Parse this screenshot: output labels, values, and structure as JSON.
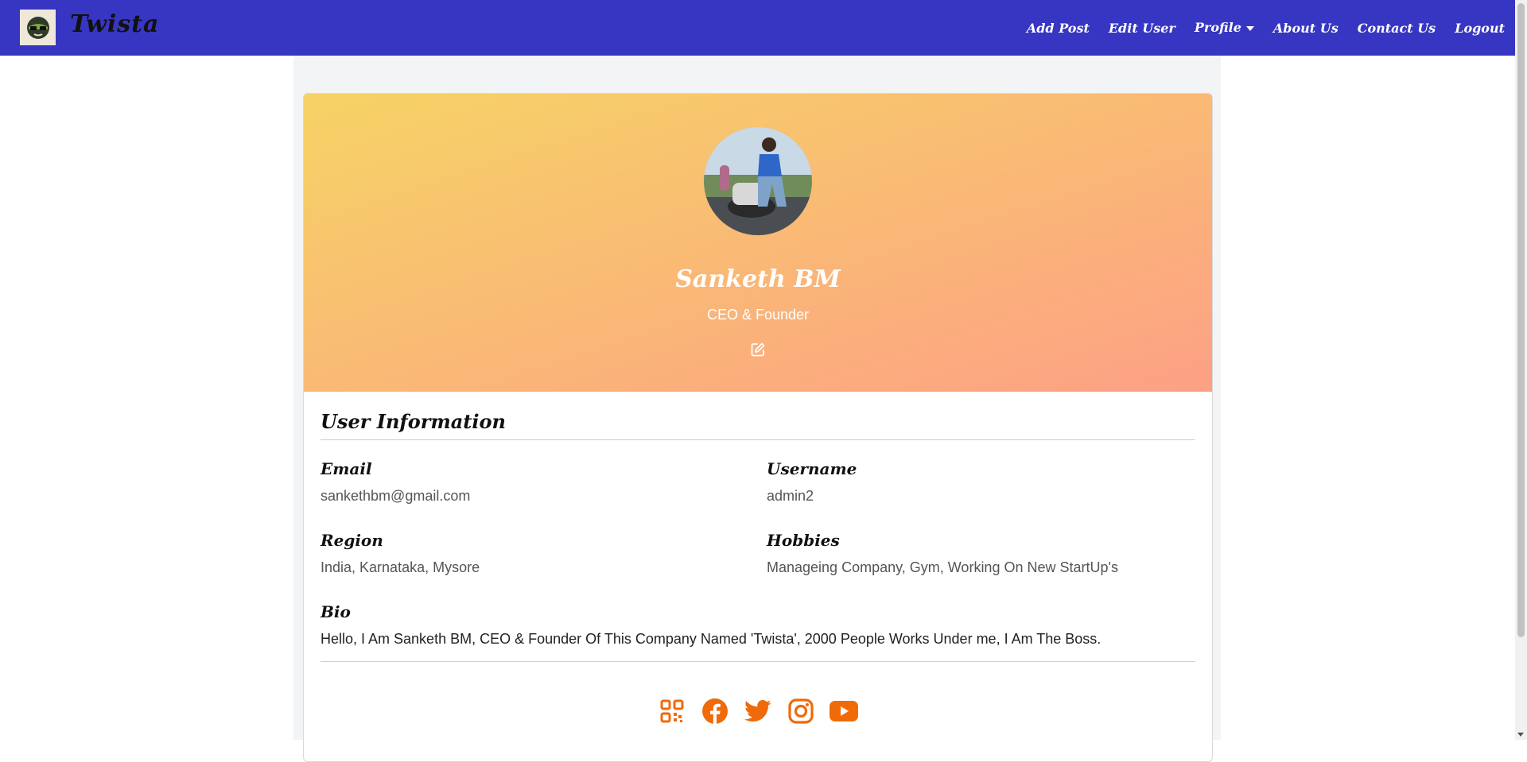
{
  "navbar": {
    "brand": "Twista",
    "links": [
      "Add Post",
      "Edit User",
      "Profile",
      "About Us",
      "Contact Us",
      "Logout"
    ]
  },
  "profile": {
    "name": "Sanketh BM",
    "role": "CEO & Founder"
  },
  "info": {
    "section_title": "User Information",
    "email_label": "Email",
    "email": "sankethbm@gmail.com",
    "username_label": "Username",
    "username": "admin2",
    "region_label": "Region",
    "region": "India, Karnataka, Mysore",
    "hobbies_label": "Hobbies",
    "hobbies": "Manageing Company, Gym, Working On New StartUp's",
    "bio_label": "Bio",
    "bio": "Hello, I Am Sanketh BM, CEO & Founder Of This Company Named 'Twista', 2000 People Works Under me, I Am The Boss."
  },
  "socials": [
    "qr-code-icon",
    "facebook-icon",
    "twitter-icon",
    "instagram-icon",
    "youtube-icon"
  ],
  "colors": {
    "navbar": "#3736c3",
    "gradient_start": "#f6d365",
    "gradient_end": "#fda085",
    "social_icons": "#f06a0a"
  }
}
